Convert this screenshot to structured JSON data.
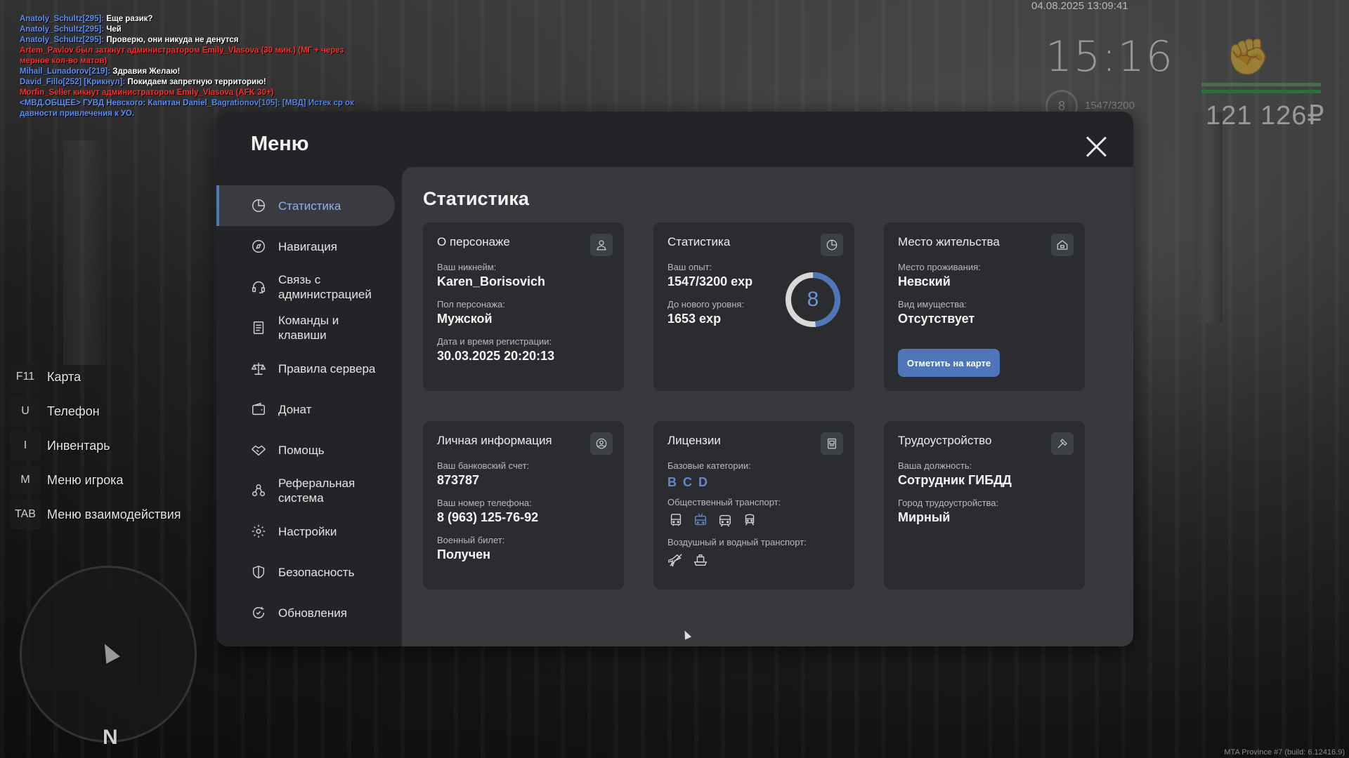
{
  "chat": [
    {
      "name": "Anatoly_Schultz[295]:",
      "text": " Еще разик?",
      "color": "blue"
    },
    {
      "name": "Anatoly_Schultz[295]:",
      "text": " Чей",
      "color": "blue"
    },
    {
      "name": "Anatoly_Schultz[295]:",
      "text": " Проверю, они никуда не денутся",
      "color": "blue"
    },
    {
      "name": "",
      "text": "Artem_Pavlov был заткнут администратором Emily_Vlasova (30 мин.) (МГ + через мерное кол-во матов)",
      "color": "red"
    },
    {
      "name": "Mihail_Lunadorov[219]:",
      "text": " Здравия Желаю!",
      "color": "blue"
    },
    {
      "name": "David_Fillo[252] [Крикнул]:",
      "text": " Покидаем запретную территорию!",
      "color": "blue"
    },
    {
      "name": "",
      "text": "Morfin_Seller кикнут администратором Emily_Vlasova (АFK 30+)",
      "color": "red"
    },
    {
      "name": "",
      "text": "<МВД.ОБЩЕЕ> ГУВД Невского: Капитан Daniel_Bagrationov[105]: [МВД] Истек ср ок давности привлечения к УО.",
      "color": "blue"
    }
  ],
  "hud": {
    "datetime": "04.08.2025 13:09:41",
    "time": "15:16",
    "level": "8",
    "exp": "1547/3200",
    "money": "121 126₽",
    "build": "MTA Province #7 (build: 6.12416.9)"
  },
  "hotkeys": [
    {
      "key": "F11",
      "label": "Карта"
    },
    {
      "key": "U",
      "label": "Телефон"
    },
    {
      "key": "I",
      "label": "Инвентарь"
    },
    {
      "key": "M",
      "label": "Меню игрока"
    },
    {
      "key": "TAB",
      "label": "Меню взаимодействия"
    }
  ],
  "radar": {
    "north": "N"
  },
  "menu": {
    "title": "Меню",
    "nav": [
      {
        "label": "Статистика",
        "icon": "pie-chart-icon",
        "active": true
      },
      {
        "label": "Навигация",
        "icon": "compass-icon"
      },
      {
        "label": "Связь с администрацией",
        "icon": "headset-icon"
      },
      {
        "label": "Команды и клавиши",
        "icon": "document-icon"
      },
      {
        "label": "Правила сервера",
        "icon": "scales-icon"
      },
      {
        "label": "Донат",
        "icon": "wallet-icon"
      },
      {
        "label": "Помощь",
        "icon": "handshake-icon"
      },
      {
        "label": "Реферальная система",
        "icon": "people-icon"
      },
      {
        "label": "Настройки",
        "icon": "gear-icon"
      },
      {
        "label": "Безопасность",
        "icon": "shield-icon"
      },
      {
        "label": "Обновления",
        "icon": "refresh-icon"
      }
    ],
    "content_title": "Статистика",
    "character": {
      "title": "О персонаже",
      "nick_label": "Ваш никнейм:",
      "nick": "Karen_Borisovich",
      "gender_label": "Пол персонажа:",
      "gender": "Мужской",
      "reg_label": "Дата и время регистрации:",
      "reg": "30.03.2025 20:20:13"
    },
    "stats": {
      "title": "Статистика",
      "exp_label": "Ваш опыт:",
      "exp": "1547/3200 exp",
      "next_label": "До нового уровня:",
      "next": "1653 exp",
      "level": "8",
      "progress": 0.483
    },
    "residence": {
      "title": "Место жительства",
      "place_label": "Место проживания:",
      "place": "Невский",
      "property_label": "Вид имущества:",
      "property": "Отсутствует",
      "button": "Отметить на карте"
    },
    "personal": {
      "title": "Личная информация",
      "bank_label": "Ваш банковский счет:",
      "bank": "873787",
      "phone_label": "Ваш номер телефона:",
      "phone": "8 (963) 125-76-92",
      "military_label": "Военный билет:",
      "military": "Получен"
    },
    "licenses": {
      "title": "Лицензии",
      "base_label": "Базовые категории:",
      "categories": [
        "B",
        "C",
        "D"
      ],
      "public_label": "Общественный транспорт:",
      "public_icons": [
        "bus-icon",
        "trolleybus-icon",
        "tram-icon",
        "train-icon"
      ],
      "air_label": "Воздушный и водный транспорт:",
      "air_icons": [
        "plane-icon",
        "boat-icon"
      ]
    },
    "employment": {
      "title": "Трудоустройство",
      "position_label": "Ваша должность:",
      "position": "Сотрудник ГИБДД",
      "city_label": "Город трудоустройства:",
      "city": "Мирный"
    }
  },
  "colors": {
    "accent": "#4f76b8",
    "panel": "#232427",
    "content_bg": "#37393d",
    "card_bg": "#2a2c30"
  }
}
